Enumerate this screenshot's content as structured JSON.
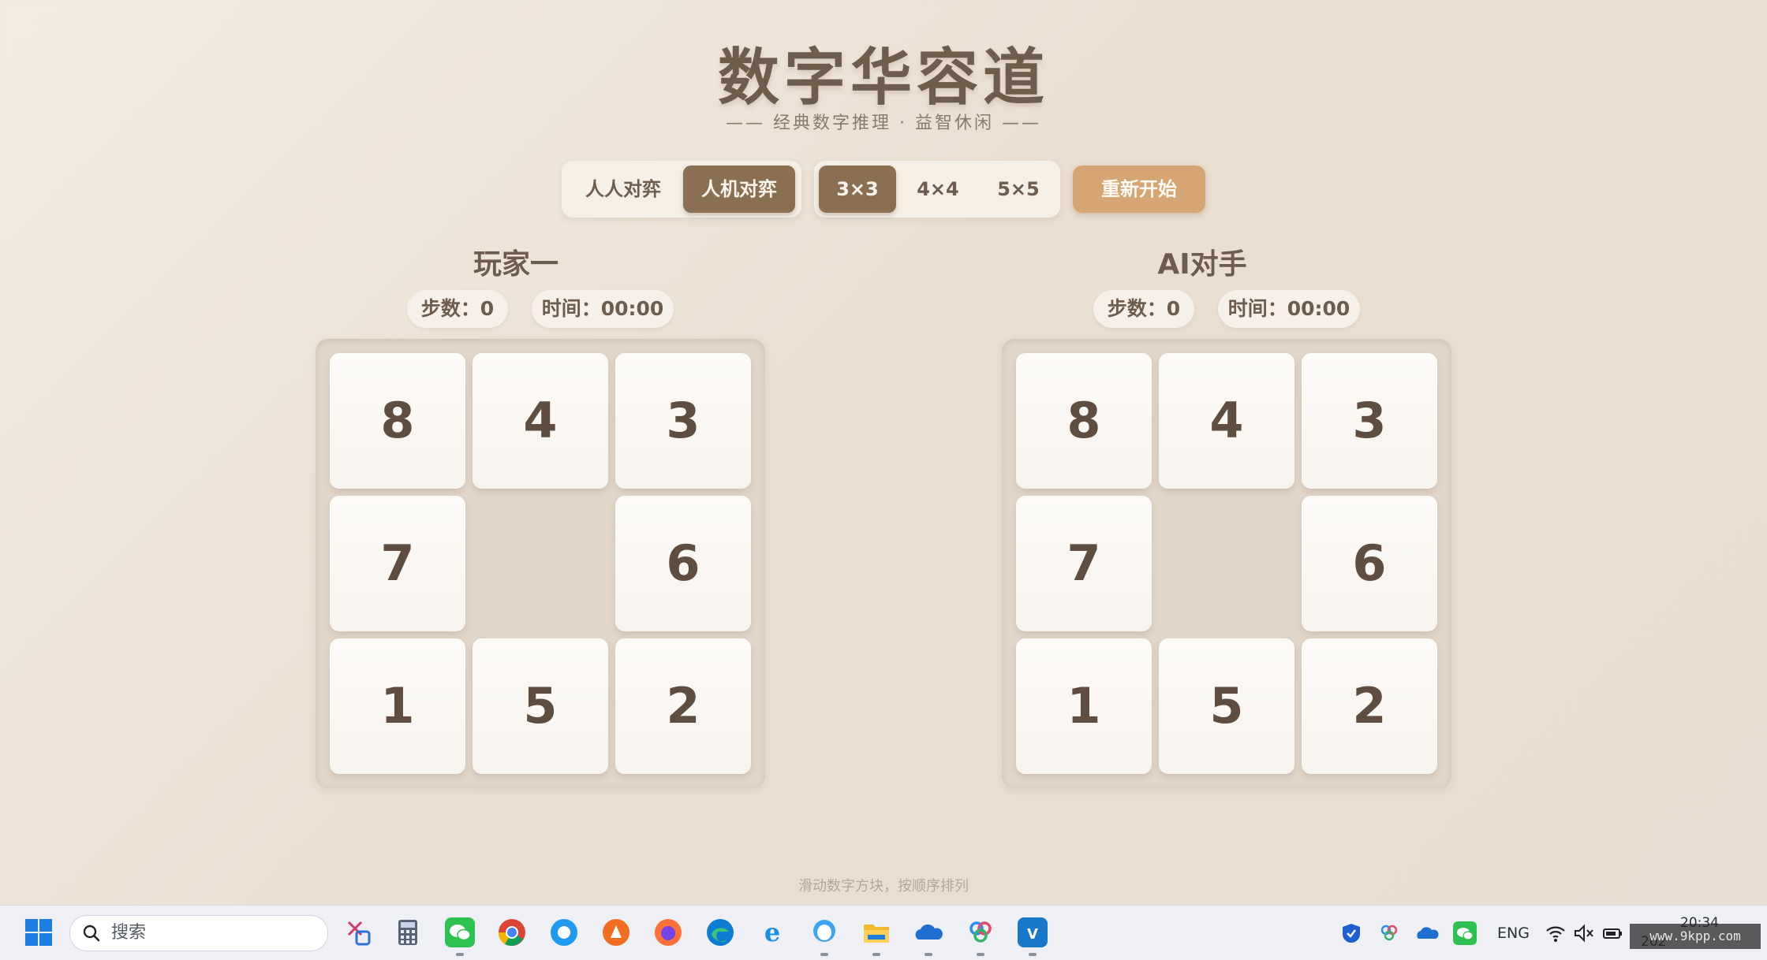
{
  "header": {
    "title": "数字华容道",
    "subtitle": "—— 经典数字推理 · 益智休闲 ——"
  },
  "toolbar": {
    "mode_pvp": "人人对弈",
    "mode_pve": "人机对弈",
    "size_3": "3×3",
    "size_4": "4×4",
    "size_5": "5×5",
    "restart": "重新开始",
    "active_mode": "人机对弈",
    "active_size": "3×3"
  },
  "players": [
    {
      "name": "玩家一",
      "steps": "步数：0",
      "time": "时间：00:00",
      "tiles": [
        "8",
        "4",
        "3",
        "7",
        "",
        "6",
        "1",
        "5",
        "2"
      ]
    },
    {
      "name": "AI对手",
      "steps": "步数：0",
      "time": "时间：00:00",
      "tiles": [
        "8",
        "4",
        "3",
        "7",
        "",
        "6",
        "1",
        "5",
        "2"
      ]
    }
  ],
  "hint": "滑动数字方块，按顺序排列",
  "taskbar": {
    "search_placeholder": "搜索",
    "lang": "ENG",
    "clock_time": "20:34",
    "clock_date": "202",
    "watermark": "www.9kpp.com",
    "apps": [
      "snipping-tool",
      "calculator",
      "wechat",
      "chrome",
      "qq-browser",
      "avast",
      "firefox",
      "edge",
      "ie",
      "qq",
      "file-explorer",
      "onedrive",
      "baidu-netdisk",
      "vscode"
    ]
  },
  "colors": {
    "accent": "#8b6f52",
    "restart": "#d6a574",
    "text": "#6e5c4c"
  }
}
